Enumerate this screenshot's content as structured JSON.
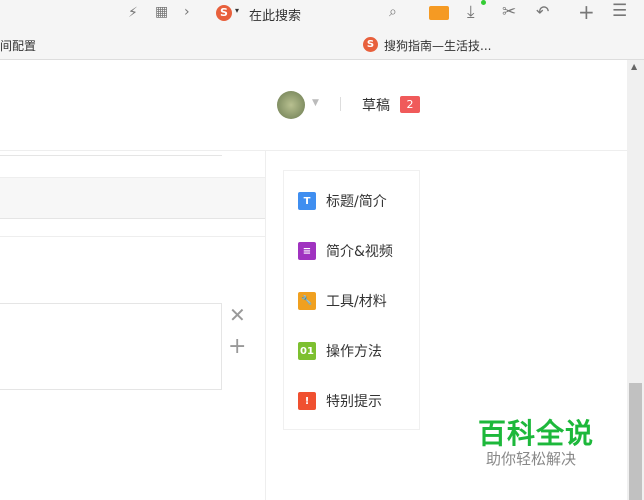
{
  "browser": {
    "search_placeholder": "在此搜索",
    "bookmark_left": "间配置",
    "bookmark_tab": "搜狗指南—生活技..."
  },
  "header": {
    "drafts_label": "草稿",
    "drafts_count": "2"
  },
  "catalog": [
    {
      "label": "标题/简介",
      "badge": "T",
      "color": "#3f8ef0"
    },
    {
      "label": "简介&视频",
      "badge": "≡",
      "color": "#a033c0"
    },
    {
      "label": "工具/材料",
      "badge": "🔧",
      "color": "#f0a020"
    },
    {
      "label": "操作方法",
      "badge": "01",
      "color": "#7dc030"
    },
    {
      "label": "特别提示",
      "badge": "!",
      "color": "#f05030"
    }
  ],
  "watermark": {
    "title": "百科全说",
    "subtitle": "助你轻松解决"
  }
}
